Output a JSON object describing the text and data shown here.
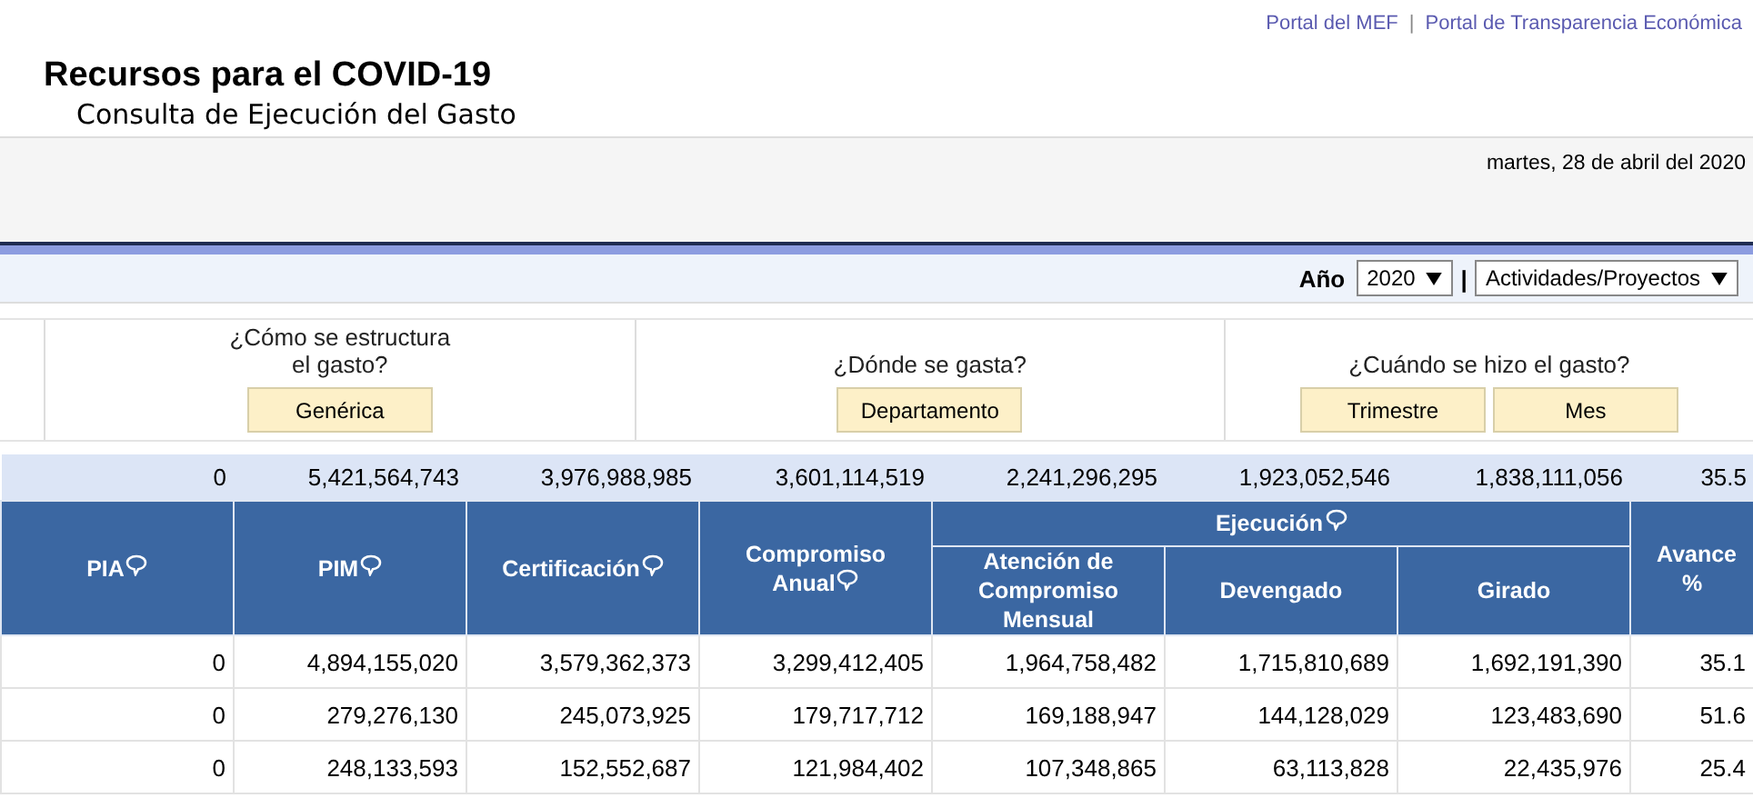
{
  "header": {
    "links": [
      "Portal del MEF",
      "Portal de Transparencia Económica"
    ],
    "link_separator": "|",
    "title": "Recursos para el COVID-19",
    "subtitle": "Consulta de Ejecución del Gasto",
    "date": "martes, 28 de abril del 2020"
  },
  "filters": {
    "year_label": "Año",
    "year": "2020",
    "separator": "|",
    "view": "Actividades/Proyectos"
  },
  "questions": [
    {
      "text": "¿Cómo se estructura el gasto?",
      "buttons": [
        "Genérica"
      ]
    },
    {
      "text": "¿Dónde se gasta?",
      "buttons": [
        "Departamento"
      ]
    },
    {
      "text": "¿Cuándo se hizo el gasto?",
      "buttons": [
        "Trimestre",
        "Mes"
      ]
    }
  ],
  "table": {
    "columns": [
      {
        "label": "PIA",
        "info_icon": true,
        "grouped": false
      },
      {
        "label": "PIM",
        "info_icon": true,
        "grouped": false
      },
      {
        "label": "Certificación",
        "info_icon": true,
        "grouped": false
      },
      {
        "label": "Compromiso Anual",
        "info_icon": true,
        "grouped": false
      },
      {
        "label": "Atención de Compromiso Mensual",
        "info_icon": false,
        "grouped": true
      },
      {
        "label": "Devengado",
        "info_icon": false,
        "grouped": true
      },
      {
        "label": "Girado",
        "info_icon": false,
        "grouped": true
      },
      {
        "label": "Avance %",
        "info_icon": false,
        "grouped": false
      }
    ],
    "column_group": {
      "label": "Ejecución",
      "info_icon": true
    },
    "totals": [
      "0",
      "5,421,564,743",
      "3,976,988,985",
      "3,601,114,519",
      "2,241,296,295",
      "1,923,052,546",
      "1,838,111,056",
      "35.5"
    ],
    "rows": [
      [
        "0",
        "4,894,155,020",
        "3,579,362,373",
        "3,299,412,405",
        "1,964,758,482",
        "1,715,810,689",
        "1,692,191,390",
        "35.1"
      ],
      [
        "0",
        "279,276,130",
        "245,073,925",
        "179,717,712",
        "169,188,947",
        "144,128,029",
        "123,483,690",
        "51.6"
      ],
      [
        "0",
        "248,133,593",
        "152,552,687",
        "121,984,402",
        "107,348,865",
        "63,113,828",
        "22,435,976",
        "25.4"
      ]
    ]
  }
}
